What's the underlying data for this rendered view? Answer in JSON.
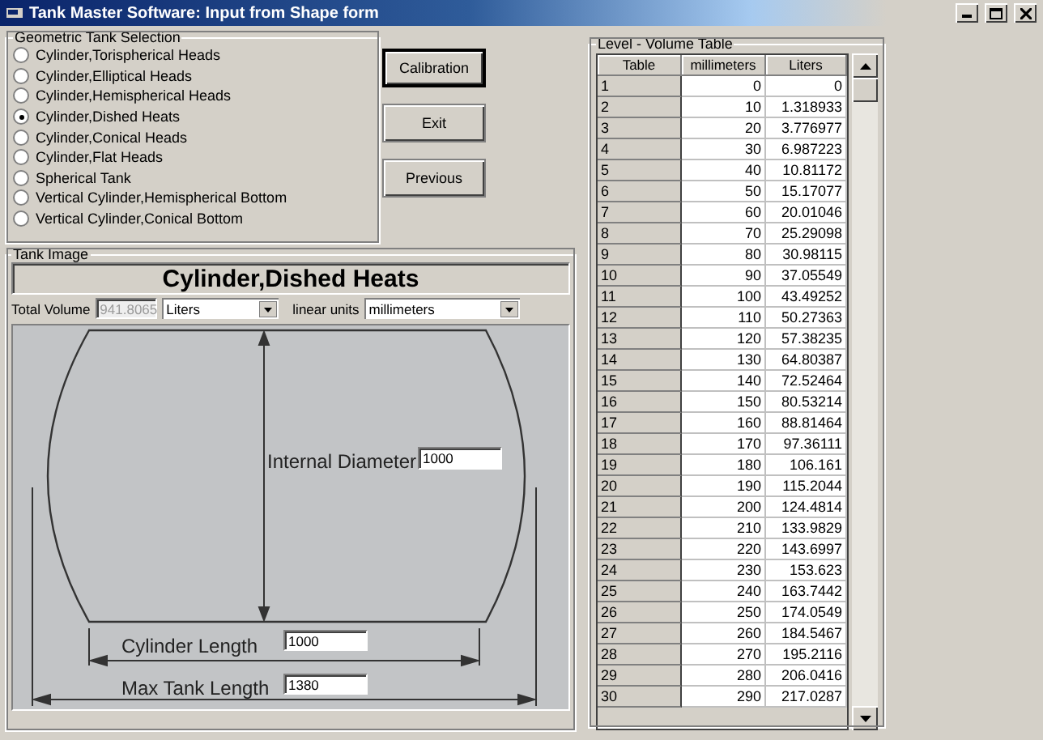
{
  "window": {
    "title": "Tank Master Software: Input from Shape form"
  },
  "shape_selection": {
    "title": "Geometric Tank Selection",
    "options": [
      {
        "label": "Cylinder,Torispherical Heads",
        "selected": false
      },
      {
        "label": "Cylinder,Elliptical Heads",
        "selected": false
      },
      {
        "label": "Cylinder,Hemispherical Heads",
        "selected": false
      },
      {
        "label": "Cylinder,Dished Heats",
        "selected": true
      },
      {
        "label": "Cylinder,Conical Heads",
        "selected": false
      },
      {
        "label": "Cylinder,Flat Heads",
        "selected": false
      },
      {
        "label": "Spherical Tank",
        "selected": false
      },
      {
        "label": "Vertical Cylinder,Hemispherical Bottom",
        "selected": false
      },
      {
        "label": "Vertical Cylinder,Conical Bottom",
        "selected": false
      }
    ]
  },
  "buttons": [
    {
      "label": "Calibration",
      "default": true
    },
    {
      "label": "Exit",
      "default": false
    },
    {
      "label": "Previous",
      "default": false
    }
  ],
  "tank_image": {
    "title": "Tank Image",
    "heading": "Cylinder,Dished Heats",
    "total_volume_label": "Total Volume",
    "total_volume": {
      "value": "941.8065",
      "disabled": true
    },
    "volume_unit": "Liters",
    "linear_units_label": "linear units",
    "linear_unit": "millimeters",
    "internal_diameter_label": "Internal Diameter",
    "internal_diameter": "1000",
    "cylinder_length_label": "Cylinder Length",
    "cylinder_length": "1000",
    "max_tank_length_label": "Max Tank Length",
    "max_tank_length": "1380"
  },
  "level_volume_table": {
    "title": "Level - Volume Table",
    "columns": [
      "Table",
      "millimeters",
      "Liters"
    ],
    "rows": [
      [
        "1",
        "0",
        "0"
      ],
      [
        "2",
        "10",
        "1.318933"
      ],
      [
        "3",
        "20",
        "3.776977"
      ],
      [
        "4",
        "30",
        "6.987223"
      ],
      [
        "5",
        "40",
        "10.81172"
      ],
      [
        "6",
        "50",
        "15.17077"
      ],
      [
        "7",
        "60",
        "20.01046"
      ],
      [
        "8",
        "70",
        "25.29098"
      ],
      [
        "9",
        "80",
        "30.98115"
      ],
      [
        "10",
        "90",
        "37.05549"
      ],
      [
        "11",
        "100",
        "43.49252"
      ],
      [
        "12",
        "110",
        "50.27363"
      ],
      [
        "13",
        "120",
        "57.38235"
      ],
      [
        "14",
        "130",
        "64.80387"
      ],
      [
        "15",
        "140",
        "72.52464"
      ],
      [
        "16",
        "150",
        "80.53214"
      ],
      [
        "17",
        "160",
        "88.81464"
      ],
      [
        "18",
        "170",
        "97.36111"
      ],
      [
        "19",
        "180",
        "106.161"
      ],
      [
        "20",
        "190",
        "115.2044"
      ],
      [
        "21",
        "200",
        "124.4814"
      ],
      [
        "22",
        "210",
        "133.9829"
      ],
      [
        "23",
        "220",
        "143.6997"
      ],
      [
        "24",
        "230",
        "153.623"
      ],
      [
        "25",
        "240",
        "163.7442"
      ],
      [
        "26",
        "250",
        "174.0549"
      ],
      [
        "27",
        "260",
        "184.5467"
      ],
      [
        "28",
        "270",
        "195.2116"
      ],
      [
        "29",
        "280",
        "206.0416"
      ],
      [
        "30",
        "290",
        "217.0287"
      ]
    ]
  }
}
